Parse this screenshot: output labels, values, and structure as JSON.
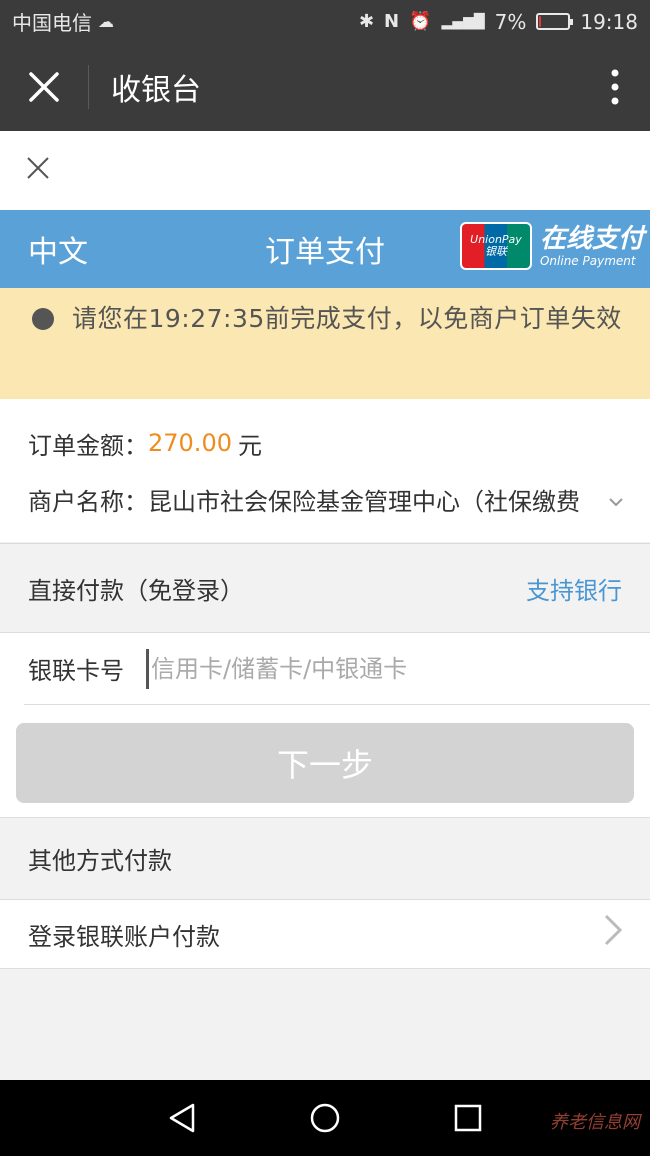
{
  "status_bar": {
    "carrier": "中国电信",
    "battery_pct": "7%",
    "battery_level": 0.07,
    "time": "19:18"
  },
  "title_bar": {
    "title": "收银台"
  },
  "header": {
    "language": "中文",
    "page_title": "订单支付",
    "logo_text": "在线支付",
    "logo_sub": "Online Payment",
    "logo_badge_top": "UnionPay",
    "logo_badge_bottom": "银联"
  },
  "notice": {
    "text": "请您在19:27:35前完成支付，以免商户订单失效"
  },
  "order": {
    "amount_label": "订单金额：",
    "amount": "270.00",
    "currency": "元",
    "merchant_label": "商户名称：",
    "merchant": "昆山市社会保险基金管理中心（社保缴费"
  },
  "direct_pay": {
    "title": "直接付款（免登录）",
    "banks_link": "支持银行"
  },
  "card": {
    "label": "银联卡号",
    "placeholder": "信用卡/储蓄卡/中银通卡",
    "next_button": "下一步"
  },
  "other": {
    "title": "其他方式付款",
    "login_option": "登录银联账户付款"
  },
  "watermark": "养老信息网",
  "colors": {
    "dark_bar": "#3b3b3b",
    "blue_header": "#5aa1d8",
    "notice_bg": "#fbe7b1",
    "amount": "#f08c1e",
    "link": "#4a96d2",
    "disabled_button": "#d3d3d3"
  },
  "icons": {
    "close": "close-icon",
    "more": "more-vertical-icon",
    "chevron": "chevron-right-icon",
    "back": "back-triangle-icon",
    "home": "home-circle-icon",
    "recent": "recent-square-icon"
  }
}
